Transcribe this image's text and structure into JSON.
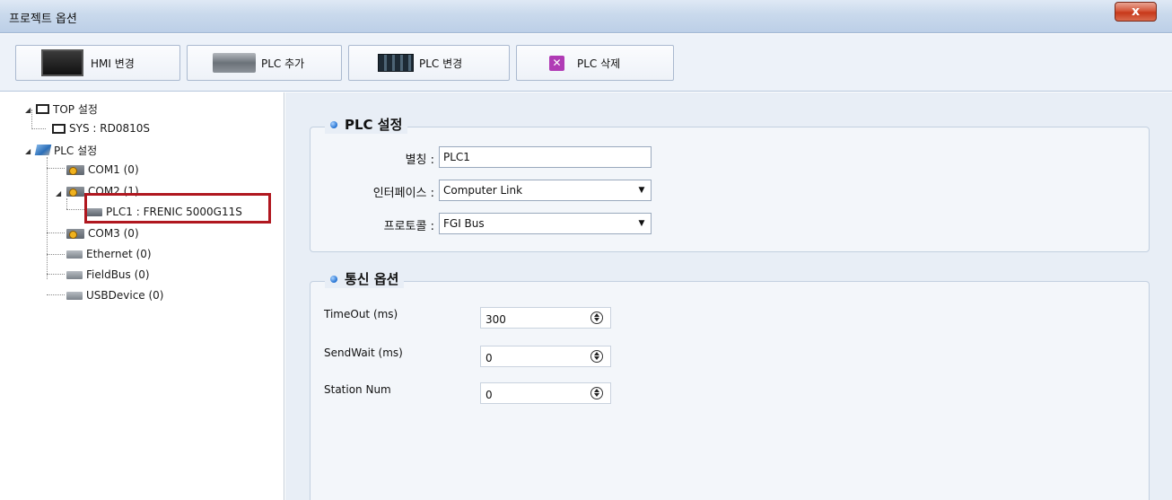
{
  "window": {
    "title": "프로젝트 옵션",
    "close_label": "x"
  },
  "toolbar": {
    "buttons": [
      {
        "label": "HMI 변경",
        "icon": "hmi-icon"
      },
      {
        "label": "PLC 추가",
        "icon": "plc-add-icon"
      },
      {
        "label": "PLC 변경",
        "icon": "plc-change-icon"
      },
      {
        "label": "PLC 삭제",
        "icon": "delete-icon"
      }
    ]
  },
  "tree": {
    "items": [
      {
        "label": "TOP 설정"
      },
      {
        "label": "SYS : RD0810S"
      },
      {
        "label": "PLC 설정"
      },
      {
        "label": "COM1 (0)"
      },
      {
        "label": "COM2 (1)"
      },
      {
        "label": "PLC1 : FRENIC 5000G11S"
      },
      {
        "label": "COM3 (0)"
      },
      {
        "label": "Ethernet (0)"
      },
      {
        "label": "FieldBus (0)"
      },
      {
        "label": "USBDevice (0)"
      }
    ],
    "selected": "PLC1 : FRENIC 5000G11S"
  },
  "plc_settings": {
    "title": "PLC 설정",
    "alias_label": "별칭 :",
    "alias_value": "PLC1",
    "interface_label": "인터페이스 :",
    "interface_value": "Computer Link",
    "protocol_label": "프로토콜 :",
    "protocol_value": "FGI Bus"
  },
  "comm_options": {
    "title": "통신 옵션",
    "fields": [
      {
        "label": "TimeOut (ms)",
        "value": "300"
      },
      {
        "label": "SendWait (ms)",
        "value": "0"
      },
      {
        "label": "Station Num",
        "value": "0"
      }
    ]
  }
}
